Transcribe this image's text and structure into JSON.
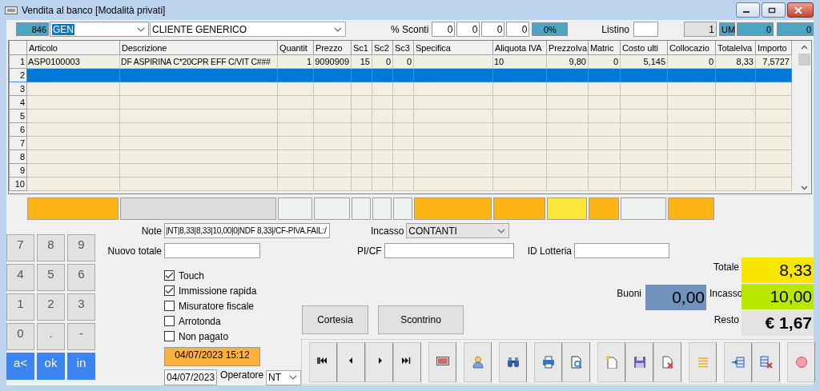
{
  "window": {
    "title": "Vendita al banco [Modalità privati]"
  },
  "header": {
    "code": "846",
    "customer_code": "GEN",
    "customer_name": "CLIENTE GENERICO",
    "discount_label": "% Sconti",
    "discounts": [
      "0",
      "0",
      "0",
      "0"
    ],
    "discount_total": "0%",
    "price_list_label": "Listino",
    "counter": "1",
    "unit_label": "UM",
    "value_1": "0",
    "value_2": "0"
  },
  "table": {
    "columns": [
      "Articolo",
      "Descrizione",
      "Quantit",
      "Prezzo",
      "Sc1",
      "Sc2",
      "Sc3",
      "Specifica",
      "Aliquota IVA",
      "PrezzoIva",
      "Matric",
      "Costo ulti",
      "Collocazio",
      "TotaleIva",
      "Importo"
    ],
    "rows": [
      {
        "number": "1",
        "selected": false,
        "cells": [
          "ASP0100003",
          "DF ASPIRINA C*20CPR EFF C/VIT C###",
          "1",
          "9090909",
          "15",
          "0",
          "0",
          "",
          "10",
          "9,80",
          "0",
          "5,145",
          "0",
          "8,33",
          "7,5727"
        ]
      },
      {
        "number": "2",
        "selected": true
      },
      {
        "number": "3",
        "selected": false
      },
      {
        "number": "4",
        "selected": false
      },
      {
        "number": "5",
        "selected": false
      },
      {
        "number": "6",
        "selected": false
      },
      {
        "number": "7",
        "selected": false
      },
      {
        "number": "8",
        "selected": false
      },
      {
        "number": "9",
        "selected": false
      },
      {
        "number": "10",
        "selected": false
      }
    ]
  },
  "summary_cells": [
    {
      "color": "#fdb515"
    },
    {
      "color": "#dcdcdc"
    },
    {
      "color": "#eef1f1"
    },
    {
      "color": "#eef1f1"
    },
    {
      "color": "#eef1f1"
    },
    {
      "color": "#eef1f1"
    },
    {
      "color": "#eef1f1"
    },
    {
      "color": "#fdb515"
    },
    {
      "color": "#fdb515"
    },
    {
      "color": "#fbe63c"
    },
    {
      "color": "#fdb515"
    },
    {
      "color": "#eef1f1"
    },
    {
      "color": "#fdb515"
    }
  ],
  "keypad": [
    {
      "label": "7",
      "kind": "digit"
    },
    {
      "label": "8",
      "kind": "digit"
    },
    {
      "label": "9",
      "kind": "digit"
    },
    {
      "label": "4",
      "kind": "digit"
    },
    {
      "label": "5",
      "kind": "digit"
    },
    {
      "label": "6",
      "kind": "digit"
    },
    {
      "label": "1",
      "kind": "digit"
    },
    {
      "label": "2",
      "kind": "digit"
    },
    {
      "label": "3",
      "kind": "digit"
    },
    {
      "label": "0",
      "kind": "digit"
    },
    {
      "label": ".",
      "kind": "digit"
    },
    {
      "label": "-",
      "kind": "digit"
    },
    {
      "label": "a<",
      "kind": "action"
    },
    {
      "label": "ok",
      "kind": "action"
    },
    {
      "label": "in",
      "kind": "action"
    }
  ],
  "form": {
    "note_label": "Note",
    "note": "|NT|8,33|8,33|10,00|0|NDF 8,33|/CF-PIVA.FAIL:/",
    "payment_label": "Incasso",
    "payment": "CONTANTI",
    "new_total_label": "Nuovo totale",
    "tax_id_label": "PI/CF",
    "lottery_label": "ID Lotteria"
  },
  "options": [
    {
      "label": "Touch",
      "checked": true
    },
    {
      "label": "Immissione rapida",
      "checked": true
    },
    {
      "label": "Misuratore fiscale",
      "checked": false
    },
    {
      "label": "Arrotonda",
      "checked": false
    },
    {
      "label": "Non pagato",
      "checked": false
    }
  ],
  "timestamp": "04/07/2023 15:12",
  "date": "04/07/2023",
  "operator_label": "Operatore",
  "operator": "NT",
  "buttons": [
    "Cortesia",
    "Scontrino"
  ],
  "vouchers": {
    "label": "Buoni",
    "value": "0,00"
  },
  "totals": [
    {
      "label": "Totale",
      "value": "8,33",
      "kind": "total"
    },
    {
      "label": "Incasso",
      "value": "10,00",
      "kind": "paid"
    },
    {
      "label": "Resto",
      "value": "€ 1,67",
      "kind": "change"
    }
  ]
}
